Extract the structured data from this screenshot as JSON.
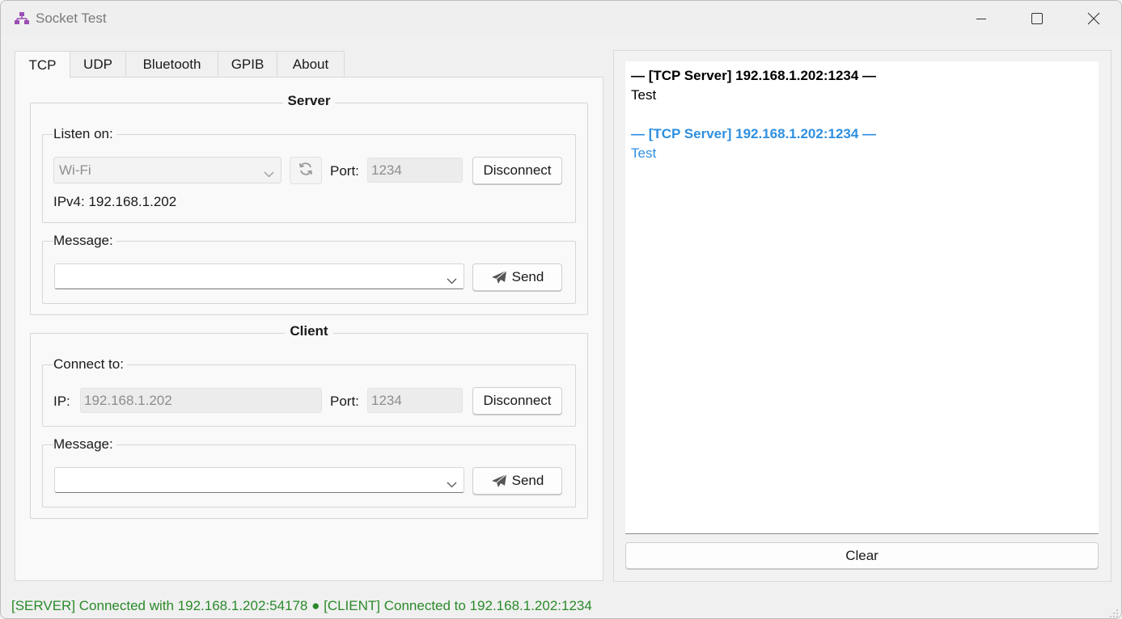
{
  "window": {
    "title": "Socket Test",
    "icon": "network-icon",
    "controls": [
      "minimize-icon",
      "maximize-icon",
      "close-icon"
    ]
  },
  "tabs": [
    {
      "label": "TCP",
      "active": true
    },
    {
      "label": "UDP",
      "active": false
    },
    {
      "label": "Bluetooth",
      "active": false
    },
    {
      "label": "GPIB",
      "active": false
    },
    {
      "label": "About",
      "active": false
    }
  ],
  "server": {
    "title": "Server",
    "listen_label": "Listen on:",
    "interface_value": "Wi-Fi",
    "refresh_icon": "refresh-icon",
    "port_label": "Port:",
    "port_value": "1234",
    "disconnect_label": "Disconnect",
    "ipv4_text": "IPv4: 192.168.1.202",
    "message_label": "Message:",
    "message_value": "",
    "send_label": "Send",
    "send_icon": "paper-plane-icon"
  },
  "client": {
    "title": "Client",
    "connect_label": "Connect to:",
    "ip_label": "IP:",
    "ip_value": "192.168.1.202",
    "port_label": "Port:",
    "port_value": "1234",
    "disconnect_label": "Disconnect",
    "message_label": "Message:",
    "message_value": "",
    "send_label": "Send",
    "send_icon": "paper-plane-icon"
  },
  "log": {
    "entries": [
      {
        "header": "— [TCP Server] 192.168.1.202:1234 —",
        "message": "Test",
        "direction": "sent",
        "color": "#000000"
      },
      {
        "header": "— [TCP Server] 192.168.1.202:1234 —",
        "message": "Test",
        "direction": "received",
        "color": "#2e8fe0"
      }
    ],
    "clear_label": "Clear"
  },
  "status": {
    "text": "[SERVER] Connected with 192.168.1.202:54178 ● [CLIENT] Connected to 192.168.1.202:1234",
    "color": "#2a8a2a"
  }
}
